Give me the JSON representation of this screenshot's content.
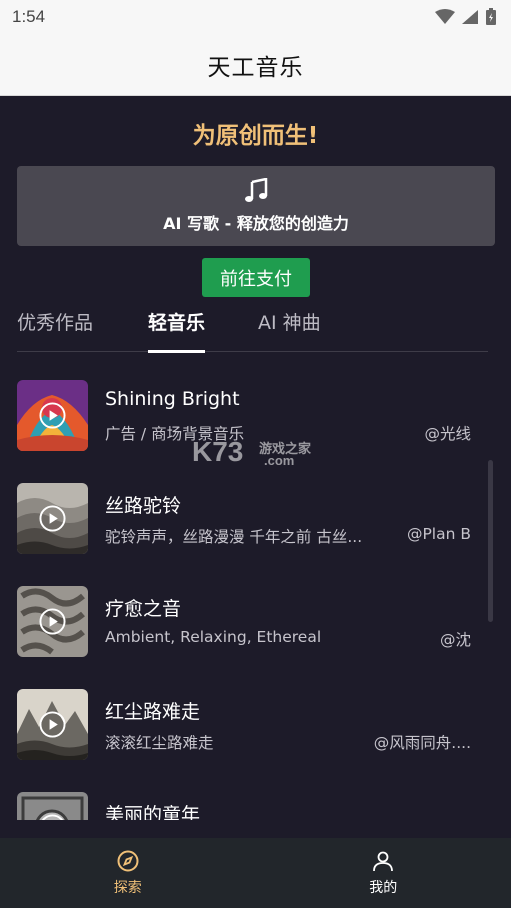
{
  "status_bar": {
    "time": "1:54"
  },
  "app": {
    "title": "天工音乐"
  },
  "slogan": "为原创而生!",
  "ai_card": {
    "label": "AI 写歌 - 释放您的创造力",
    "icon": "music-note-icon"
  },
  "pay_button": {
    "label": "前往支付"
  },
  "tabs": [
    {
      "label": "优秀作品",
      "active": false
    },
    {
      "label": "轻音乐",
      "active": true
    },
    {
      "label": "AI 神曲",
      "active": false
    }
  ],
  "songs": [
    {
      "title": "Shining Bright",
      "desc": "广告 / 商场背景音乐",
      "author": "@光线"
    },
    {
      "title": "丝路驼铃",
      "desc": "驼铃声声，丝路漫漫 千年之前 古丝...",
      "author": "@Plan B"
    },
    {
      "title": "疗愈之音",
      "desc": "Ambient, Relaxing, Ethereal",
      "author": "@沈"
    },
    {
      "title": "红尘路难走",
      "desc": "滚滚红尘路难走",
      "author": "@风雨同舟...."
    },
    {
      "title": "美丽的童年",
      "desc": "",
      "author": ""
    }
  ],
  "watermark": {
    "main": "K73",
    "sub": "游戏之家",
    "domain": ".com"
  },
  "bottom_nav": [
    {
      "label": "探索",
      "icon": "compass-icon",
      "active": true
    },
    {
      "label": "我的",
      "icon": "user-icon",
      "active": false
    }
  ],
  "colors": {
    "accent_gold": "#f0c078",
    "pay_green": "#1f9d4f",
    "background": "#1d1b29",
    "active_nav": "#f0c078"
  }
}
